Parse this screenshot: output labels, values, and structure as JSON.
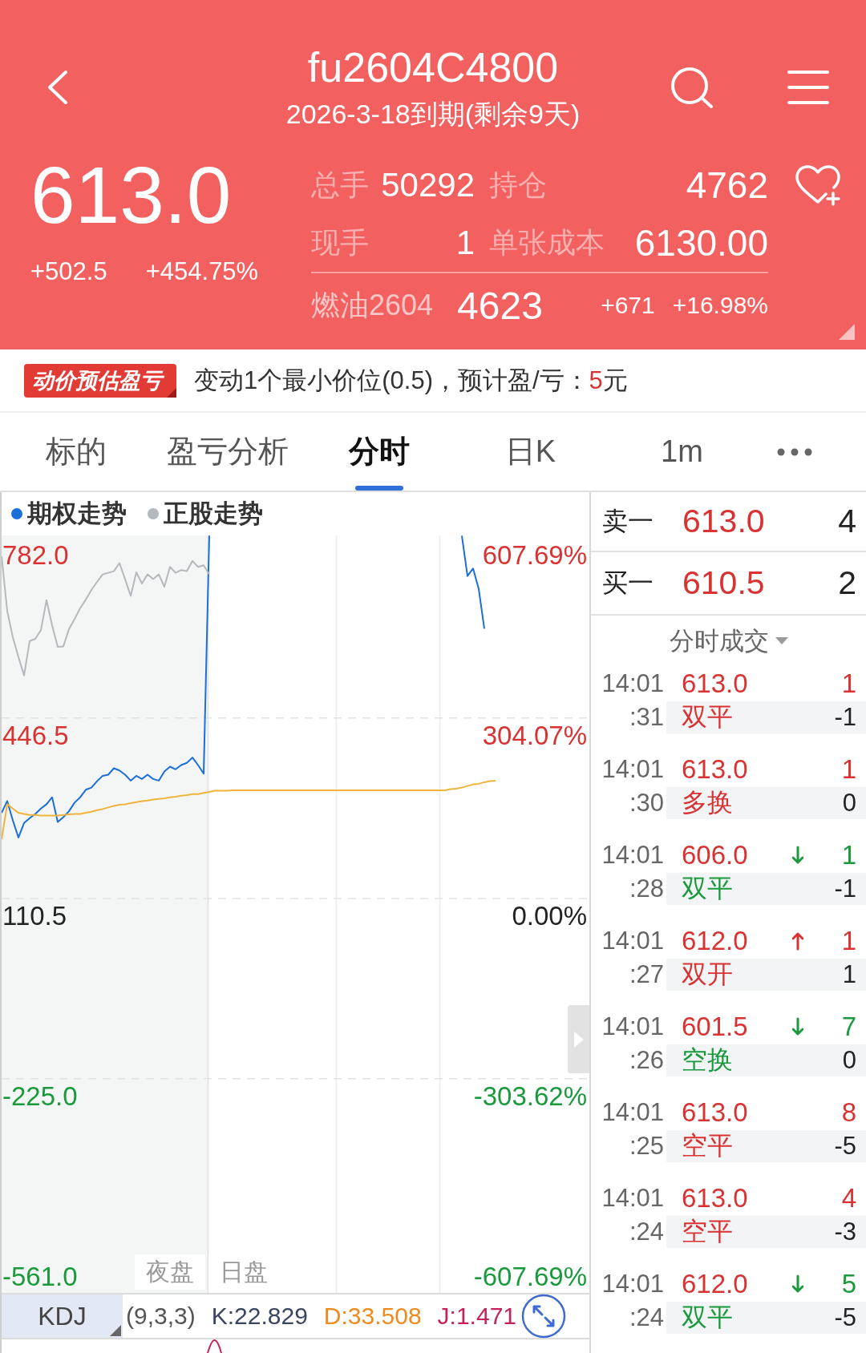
{
  "header": {
    "title": "fu2604C4800",
    "subtitle": "2026-3-18到期(剩余9天)",
    "price": "613.0",
    "change": "+502.5",
    "change_pct": "+454.75%",
    "stats": [
      [
        {
          "label": "总手",
          "value": "50292"
        },
        {
          "label": "持仓",
          "value": "4762"
        }
      ],
      [
        {
          "label": "现手",
          "value": "1"
        },
        {
          "label": "单张成本",
          "value": "6130.00"
        }
      ]
    ],
    "underlying": {
      "name": "燃油2604",
      "price": "4623",
      "change": "+671",
      "change_pct": "+16.98%"
    }
  },
  "estimate_banner": {
    "badge": "动价预估盈亏",
    "text": "变动1个最小价位(0.5)，预计盈/亏：",
    "value": "5",
    "unit": "元"
  },
  "tabs": [
    {
      "label": "标的",
      "selected": false
    },
    {
      "label": "盈亏分析",
      "selected": false
    },
    {
      "label": "分时",
      "selected": true
    },
    {
      "label": "日K",
      "selected": false
    },
    {
      "label": "1m",
      "selected": false
    }
  ],
  "chart": {
    "chart_data": {
      "type": "line",
      "grid": true,
      "ylim": [
        -623.7,
        786.5
      ],
      "yticks": [
        {
          "value": 782.0,
          "label": "782.0"
        },
        {
          "value": 446.5,
          "label": "446.5"
        },
        {
          "value": 110.5,
          "label": "110.5"
        },
        {
          "value": -225.0,
          "label": "-225.0"
        },
        {
          "value": -561.0,
          "label": "-561.0"
        }
      ],
      "series": [
        {
          "name": "期权走势",
          "color": "#1a6fd8",
          "values": [
            270,
            292,
            256,
            224,
            251,
            260,
            268,
            278,
            286,
            299,
            253,
            262,
            273,
            289,
            299,
            313,
            317,
            329,
            339,
            341,
            353,
            349,
            341,
            330,
            339,
            333,
            341,
            333,
            330,
            347,
            356,
            351,
            359,
            363,
            373,
            359,
            343,
            786,
            null,
            null,
            null,
            null,
            null,
            null,
            null,
            null,
            null,
            null,
            null,
            null,
            null,
            null,
            null,
            null,
            null,
            null,
            null,
            null,
            null,
            null,
            null,
            null,
            null,
            null,
            null,
            null,
            null,
            null,
            null,
            null,
            null,
            null,
            null,
            null,
            null,
            null,
            null,
            null,
            null,
            null,
            null,
            null,
            786,
            711,
            725,
            687,
            613,
            null,
            null,
            null,
            null,
            null,
            null,
            null,
            null,
            null,
            null,
            null,
            null,
            null,
            null,
            null,
            null,
            null
          ]
        },
        {
          "name": "正股走势",
          "color": "#b5b8bd",
          "values": [
            748,
            646,
            597,
            560,
            526,
            590,
            594,
            610,
            666,
            619,
            579,
            580,
            612,
            631,
            651,
            667,
            685,
            700,
            714,
            717,
            720,
            735,
            705,
            674,
            718,
            697,
            714,
            705,
            714,
            691,
            728,
            717,
            722,
            720,
            739,
            728,
            731,
            714,
            null,
            null,
            null,
            null,
            null,
            null,
            null,
            null,
            null,
            null,
            null,
            null,
            null,
            null,
            null,
            null,
            null,
            null,
            null,
            null,
            null,
            null,
            null,
            null,
            null,
            null,
            null,
            null,
            null,
            null,
            null,
            null,
            null,
            null,
            null,
            null,
            null,
            null,
            null,
            null,
            null,
            null,
            null,
            null,
            null,
            null,
            null,
            null,
            null,
            null,
            null,
            null,
            null,
            null,
            null,
            null,
            null,
            null,
            null,
            null,
            null,
            null,
            null,
            null
          ]
        },
        {
          "color": "#f0b43c",
          "values": [
            221,
            286,
            278,
            270,
            268,
            266,
            266,
            265,
            265,
            265,
            265,
            266,
            267,
            268,
            268,
            270,
            272,
            275,
            277,
            280,
            283,
            285,
            286,
            288,
            290,
            292,
            293,
            295,
            296,
            297,
            299,
            300,
            302,
            303,
            305,
            305,
            307,
            309,
            311,
            311,
            311,
            312,
            312,
            312,
            312,
            312,
            312,
            312,
            312,
            312,
            312,
            312,
            312,
            312,
            312,
            312,
            312,
            312,
            312,
            312,
            312,
            312,
            312,
            312,
            312,
            312,
            312,
            312,
            312,
            312,
            312,
            312,
            312,
            312,
            312,
            312,
            312,
            312,
            312,
            312,
            314,
            315,
            317,
            320,
            323,
            324,
            327,
            329,
            330,
            null,
            null,
            null,
            null,
            null,
            null,
            null,
            null,
            null,
            null,
            null,
            null,
            null,
            null,
            null,
            null,
            null
          ]
        }
      ]
    },
    "percent_labels": [
      {
        "label": "607.69%",
        "color": "#d93232"
      },
      {
        "label": "304.07%",
        "color": "#d93232"
      },
      {
        "label": "0.00%",
        "color": "#222222"
      },
      {
        "label": "-303.62%",
        "color": "#1a9a3c"
      },
      {
        "label": "-607.69%",
        "color": "#1a9a3c"
      }
    ],
    "sessions": [
      {
        "label": "夜盘"
      },
      {
        "label": "日盘"
      }
    ],
    "indicator": {
      "name": "KDJ",
      "params": "(9,3,3)",
      "values": [
        {
          "label": "K:22.829",
          "color": "#3a4661"
        },
        {
          "label": "D:33.508",
          "color": "#ef8a1e"
        },
        {
          "label": "J:1.471",
          "color": "#c2245a"
        }
      ]
    }
  },
  "order_book": [
    {
      "label": "卖一",
      "price": "613.0",
      "volume": "4"
    },
    {
      "label": "买一",
      "price": "610.5",
      "volume": "2"
    }
  ],
  "trades": {
    "title": "分时成交",
    "items": [
      {
        "time": "14:01",
        "seconds": ":31",
        "price": "613.0",
        "up_arrow": false,
        "down_arrow": false,
        "volume": "1",
        "type": "双平",
        "net": "-1",
        "color": "#d93232"
      },
      {
        "time": "14:01",
        "seconds": ":30",
        "price": "613.0",
        "up_arrow": false,
        "down_arrow": false,
        "volume": "1",
        "type": "多换",
        "net": "0",
        "color": "#d93232"
      },
      {
        "time": "14:01",
        "seconds": ":28",
        "price": "606.0",
        "up_arrow": false,
        "down_arrow": true,
        "volume": "1",
        "type": "双平",
        "net": "-1",
        "color": "#1a9a3c"
      },
      {
        "time": "14:01",
        "seconds": ":27",
        "price": "612.0",
        "up_arrow": true,
        "down_arrow": false,
        "volume": "1",
        "type": "双开",
        "net": "1",
        "color": "#d93232"
      },
      {
        "time": "14:01",
        "seconds": ":26",
        "price": "601.5",
        "up_arrow": false,
        "down_arrow": true,
        "volume": "7",
        "type": "空换",
        "net": "0",
        "color": "#1a9a3c"
      },
      {
        "time": "14:01",
        "seconds": ":25",
        "price": "613.0",
        "up_arrow": false,
        "down_arrow": false,
        "volume": "8",
        "type": "空平",
        "net": "-5",
        "color": "#d93232"
      },
      {
        "time": "14:01",
        "seconds": ":24",
        "price": "613.0",
        "up_arrow": false,
        "down_arrow": false,
        "volume": "4",
        "type": "空平",
        "net": "-3",
        "color": "#d93232"
      },
      {
        "time": "14:01",
        "seconds": ":24",
        "price": "612.0",
        "up_arrow": false,
        "down_arrow": true,
        "volume": "5",
        "type": "双平",
        "net": "-5",
        "color": "#1a9a3c"
      }
    ]
  }
}
